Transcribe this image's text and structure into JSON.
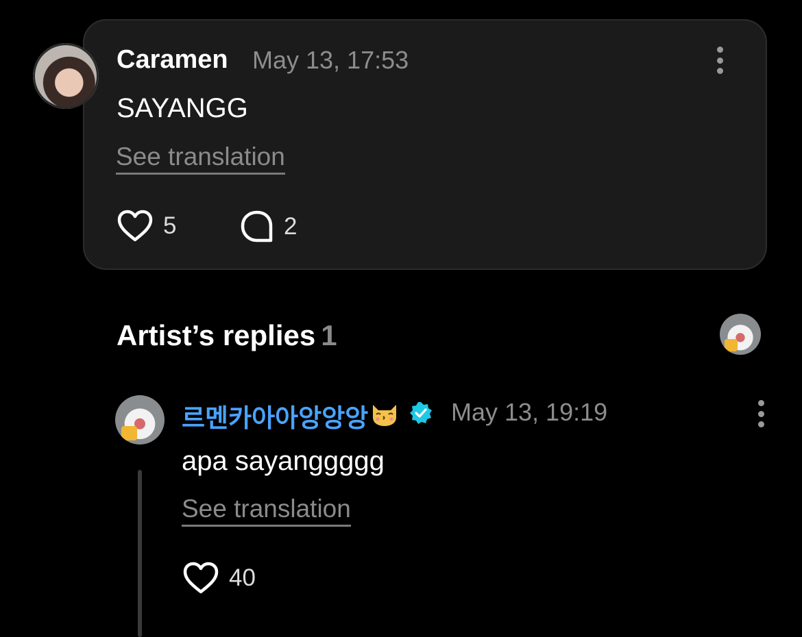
{
  "comment": {
    "author": "Caramen",
    "timestamp": "May 13, 17:53",
    "text": "SAYANGG",
    "see_translation": "See translation",
    "likes": "5",
    "replies": "2"
  },
  "artist_replies": {
    "title": "Artist’s replies",
    "count": "1"
  },
  "reply": {
    "author": "르멘카아아앙앙앙",
    "author_emoji": "kissing-cat-emoji",
    "timestamp": "May 13, 19:19",
    "text": "apa sayanggggg",
    "see_translation": "See translation",
    "likes": "40"
  },
  "colors": {
    "background": "#000000",
    "card": "#1b1b1b",
    "artist_name": "#4aa3ff",
    "verified_badge": "#1ec8e6",
    "muted": "#8d8d8d"
  },
  "icons": [
    "heart-icon",
    "comment-bubble-icon",
    "more-options-icon",
    "verified-badge-icon"
  ]
}
